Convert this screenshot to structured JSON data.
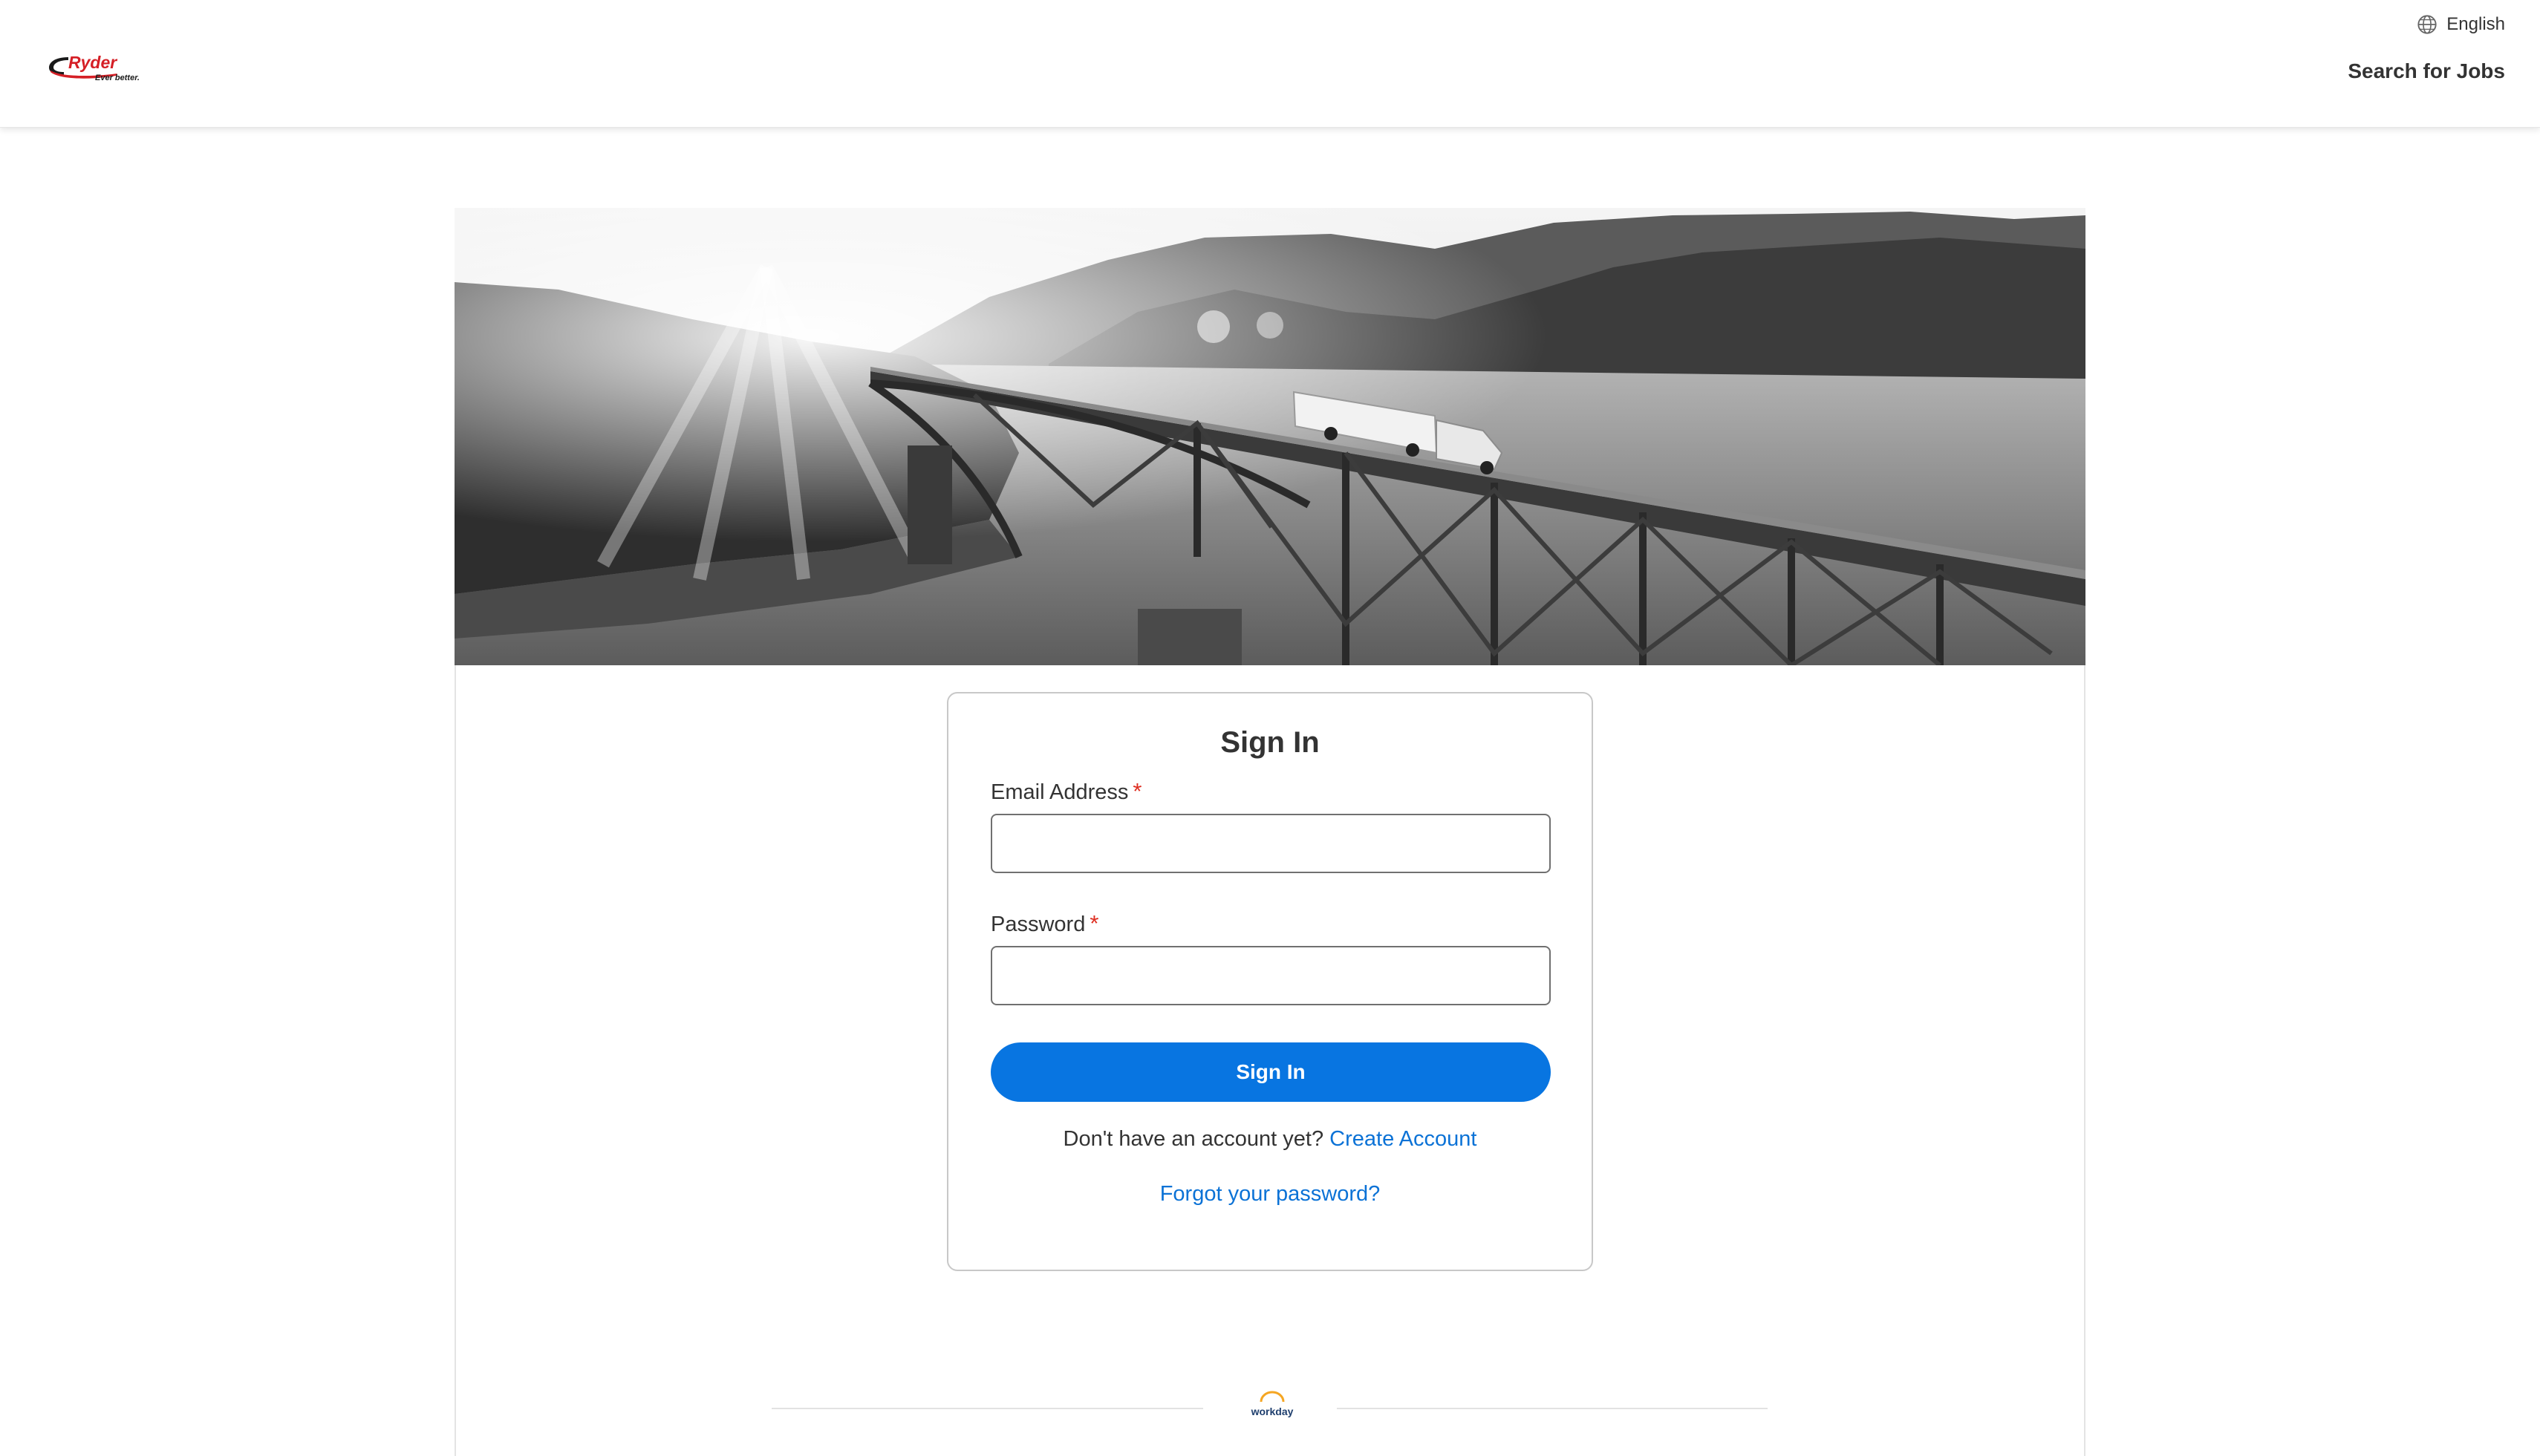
{
  "header": {
    "brand": {
      "name": "Ryder",
      "tagline": "Ever better."
    },
    "language": "English",
    "search_jobs": "Search for Jobs"
  },
  "sign_in": {
    "title": "Sign In",
    "email_label": "Email Address",
    "email_value": "",
    "password_label": "Password",
    "password_value": "",
    "required_marker": "*",
    "submit_label": "Sign In",
    "no_account_text": "Don't have an account yet?",
    "create_account": "Create Account",
    "forgot_password": "Forgot your password?"
  },
  "footer": {
    "logo_text": "workday"
  },
  "colors": {
    "primary_button": "#0875e1",
    "link": "#0b72d6",
    "required": "#de2e21",
    "brand_red": "#d51f26"
  },
  "icons": {
    "language": "globe-icon",
    "brand": "ryder-logo",
    "footer": "workday-logo"
  }
}
